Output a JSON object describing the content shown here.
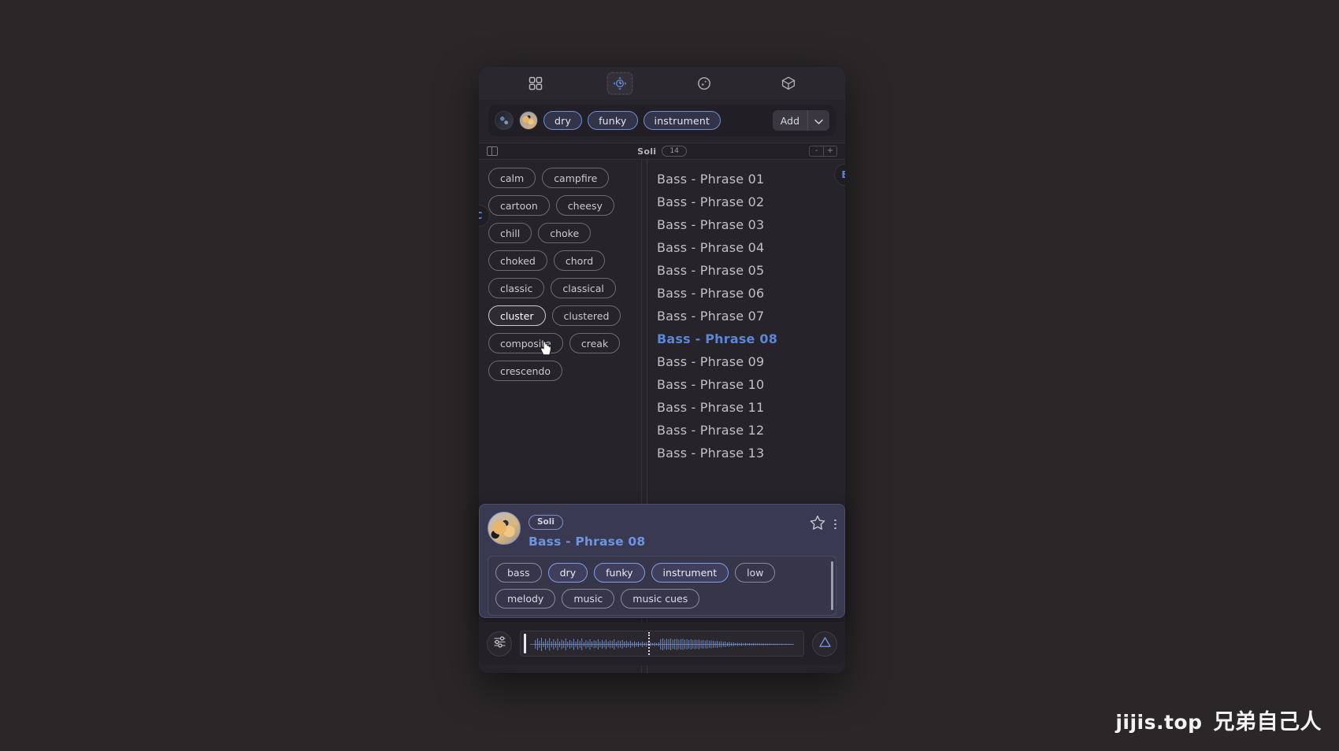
{
  "app": {
    "background_color": "#2b2729",
    "window_color": "#26232a",
    "accent_color": "#5b87d8"
  },
  "top_nav": {
    "items": [
      {
        "icon": "grid-icon",
        "label": "Browse",
        "active": false
      },
      {
        "icon": "atom-icon",
        "label": "Explore",
        "active": true
      },
      {
        "icon": "circle-icon",
        "label": "Sphere",
        "active": false
      },
      {
        "icon": "cube-icon",
        "label": "Packs",
        "active": false
      }
    ]
  },
  "filter_bar": {
    "avatars": [
      "avatar-thumbnail-1",
      "avatar-thumbnail-2"
    ],
    "chips": [
      {
        "label": "dry",
        "selected": true
      },
      {
        "label": "funky",
        "selected": true
      },
      {
        "label": "instrument",
        "selected": true
      }
    ],
    "add_label": "Add",
    "caret_icon": "chevron-down-icon"
  },
  "sub_header": {
    "panel_toggle_icon": "panel-toggle-icon",
    "title": "Soli",
    "count": "14",
    "zoom_out_label": "-",
    "zoom_in_label": "+"
  },
  "tags_pane": {
    "letter_index": "C",
    "tags": [
      {
        "label": "calm",
        "hover": false
      },
      {
        "label": "campfire",
        "hover": false
      },
      {
        "label": "cartoon",
        "hover": false
      },
      {
        "label": "cheesy",
        "hover": false
      },
      {
        "label": "chill",
        "hover": false
      },
      {
        "label": "choke",
        "hover": false
      },
      {
        "label": "choked",
        "hover": false
      },
      {
        "label": "chord",
        "hover": false
      },
      {
        "label": "classic",
        "hover": false
      },
      {
        "label": "classical",
        "hover": false
      },
      {
        "label": "cluster",
        "hover": true
      },
      {
        "label": "clustered",
        "hover": false
      },
      {
        "label": "composite",
        "hover": false
      },
      {
        "label": "creak",
        "hover": false
      },
      {
        "label": "crescendo",
        "hover": false
      }
    ]
  },
  "list_pane": {
    "letter_index": "B",
    "items": [
      {
        "label": "Bass - Phrase 01",
        "active": false
      },
      {
        "label": "Bass - Phrase 02",
        "active": false
      },
      {
        "label": "Bass - Phrase 03",
        "active": false
      },
      {
        "label": "Bass - Phrase 04",
        "active": false
      },
      {
        "label": "Bass - Phrase 05",
        "active": false
      },
      {
        "label": "Bass - Phrase 06",
        "active": false
      },
      {
        "label": "Bass - Phrase 07",
        "active": false
      },
      {
        "label": "Bass - Phrase 08",
        "active": true
      },
      {
        "label": "Bass - Phrase 09",
        "active": false
      },
      {
        "label": "Bass - Phrase 10",
        "active": false
      },
      {
        "label": "Bass - Phrase 11",
        "active": false
      },
      {
        "label": "Bass - Phrase 12",
        "active": false
      },
      {
        "label": "Bass - Phrase 13",
        "active": false
      }
    ]
  },
  "detail_card": {
    "avatar": "sample-avatar",
    "badge": "Soli",
    "title": "Bass - Phrase 08",
    "favorite_icon": "star-icon",
    "menu_icon": "kebab-menu-icon",
    "tags": [
      {
        "label": "bass",
        "selected": false
      },
      {
        "label": "dry",
        "selected": true
      },
      {
        "label": "funky",
        "selected": true
      },
      {
        "label": "instrument",
        "selected": true
      },
      {
        "label": "low",
        "selected": false
      },
      {
        "label": "melody",
        "selected": false
      },
      {
        "label": "music",
        "selected": false
      },
      {
        "label": "music cues",
        "selected": false
      }
    ]
  },
  "player": {
    "settings_icon": "mixer-sliders-icon",
    "export_icon": "triangle-icon",
    "waveform_color": "#7b9ad8",
    "playhead_position_percent": 45
  },
  "watermark": {
    "site": "jijis.top",
    "text": "兄弟自己人"
  }
}
